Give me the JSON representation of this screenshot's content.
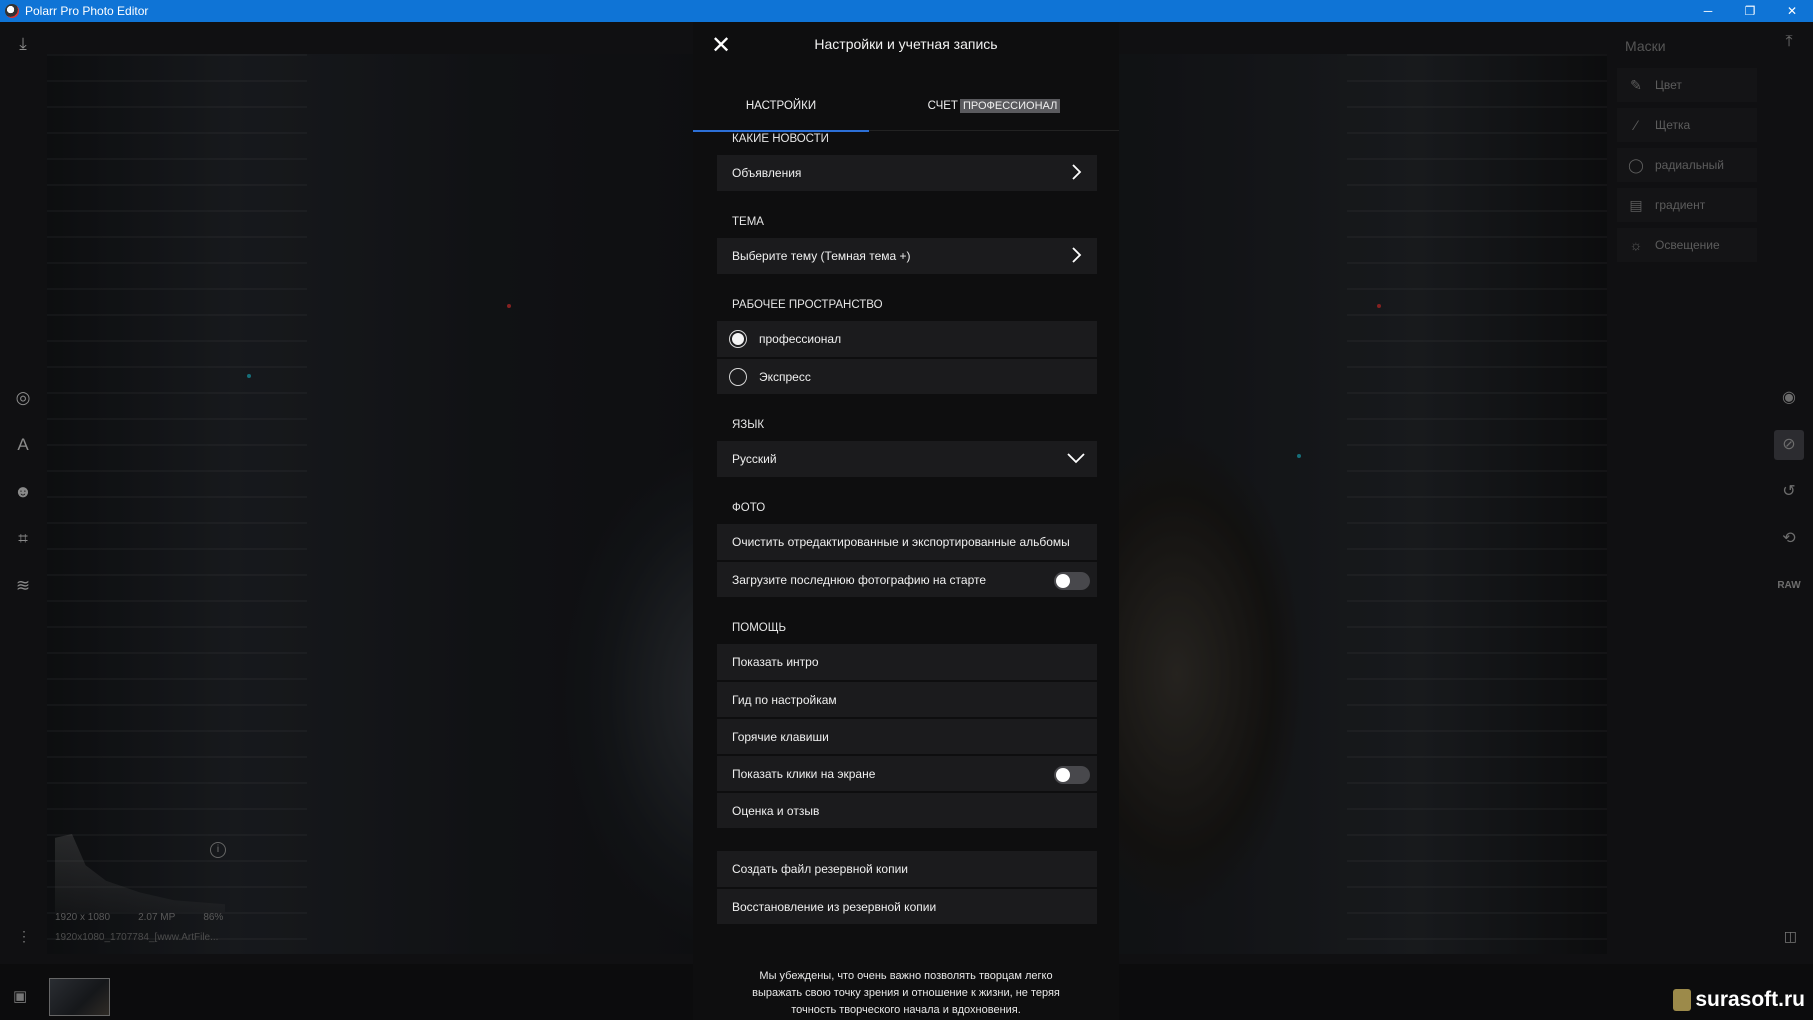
{
  "window": {
    "title": "Polarr Pro Photo Editor",
    "controls": {
      "minimize": "─",
      "maximize": "❐",
      "close": "✕"
    }
  },
  "modal": {
    "title": "Настройки и учетная запись",
    "tabs": {
      "settings": "НАСТРОЙКИ",
      "account": "СЧЕТ",
      "account_badge": "ПРОФЕССИОНАЛ"
    },
    "sections": {
      "news": {
        "label": "КАКИЕ НОВОСТИ",
        "item": "Объявления"
      },
      "theme": {
        "label": "ТЕМА",
        "item": "Выберите тему (Темная тема +)"
      },
      "workspace": {
        "label": "РАБОЧЕЕ ПРОСТРАНСТВО",
        "option_pro": "профессионал",
        "option_express": "Экспресс",
        "selected": "профессионал"
      },
      "language": {
        "label": "ЯЗЫК",
        "value": "Русский"
      },
      "photo": {
        "label": "ФОТО",
        "clear_albums": "Очистить отредактированные и экспортированные альбомы",
        "load_last": "Загрузите последнюю фотографию на старте"
      },
      "help": {
        "label": "ПОМОЩЬ",
        "show_intro": "Показать интро",
        "settings_guide": "Гид по настройкам",
        "hotkeys": "Горячие клавиши",
        "show_clicks": "Показать клики на экране",
        "rate": "Оценка и отзыв"
      },
      "backup": {
        "create": "Создать файл резервной копии",
        "restore": "Восстановление из резервной копии"
      }
    },
    "footer_note": "Мы убеждены, что очень важно позволять творцам легко выражать свою точку зрения и отношение к жизни, не теряя точность творческого начала и вдохновения."
  },
  "right_panel": {
    "title": "Маски",
    "items": [
      "Цвет",
      "Щетка",
      "радиальный",
      "градиент",
      "Освещение"
    ],
    "raw_label": "RAW"
  },
  "histogram": {
    "dimensions": "1920 x 1080",
    "megapixels": "2.07 MP",
    "zoom": "86%"
  },
  "filename": "1920x1080_1707784_[www.ArtFile...",
  "watermark": "surasoft.ru"
}
